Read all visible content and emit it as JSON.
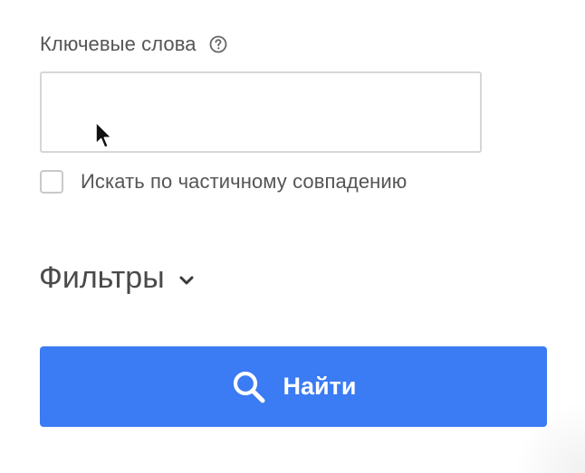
{
  "keywords": {
    "label": "Ключевые слова",
    "help_icon": "question-circle-icon",
    "input_value": "",
    "input_placeholder": ""
  },
  "partial_match": {
    "label": "Искать по частичному совпадению",
    "checked": false
  },
  "filters": {
    "title": "Фильтры",
    "expand_icon": "chevron-down-icon",
    "expanded": false
  },
  "search_button": {
    "label": "Найти",
    "icon": "search-icon"
  },
  "colors": {
    "accent": "#3b7bf3",
    "text": "#555555",
    "border": "#d6d6d6"
  }
}
